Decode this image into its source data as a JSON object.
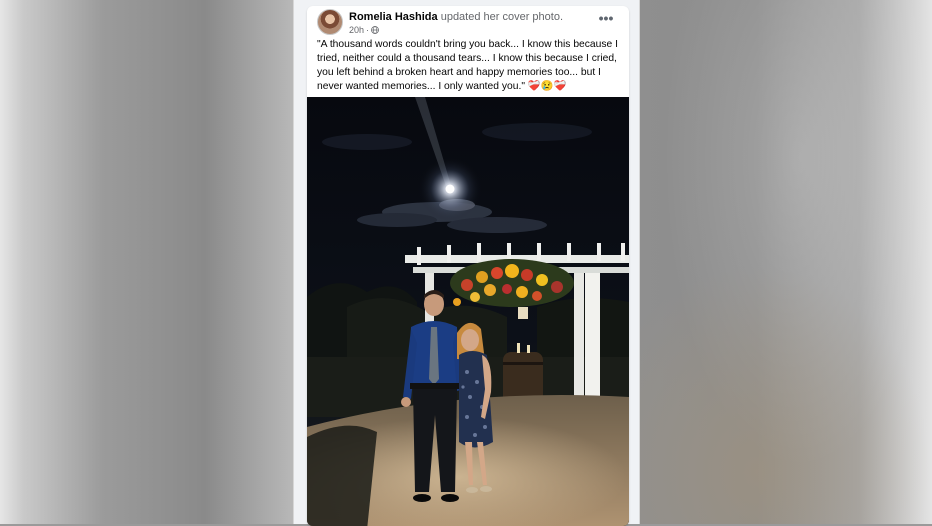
{
  "post": {
    "author": "Romelia Hashida",
    "action": "updated her cover photo.",
    "time": "20h",
    "separator": "·",
    "privacy_icon": "globe-icon",
    "more_icon": "more-options-icon",
    "more_glyph": "•••",
    "caption": "\"A thousand words couldn't bring you back... I know this because I tried, neither could a thousand tears... I know this because I cried, you left behind a broken heart and happy memories too... but I never wanted memories... I only wanted you.\" ❤️‍🩹😢❤️‍🩹"
  },
  "photo": {
    "subject": "couple-under-wedding-arbor-at-night"
  },
  "colors": {
    "page_bg": "#f0f2f5",
    "card_bg": "#ffffff",
    "text_primary": "#050505",
    "text_secondary": "#65676b"
  }
}
